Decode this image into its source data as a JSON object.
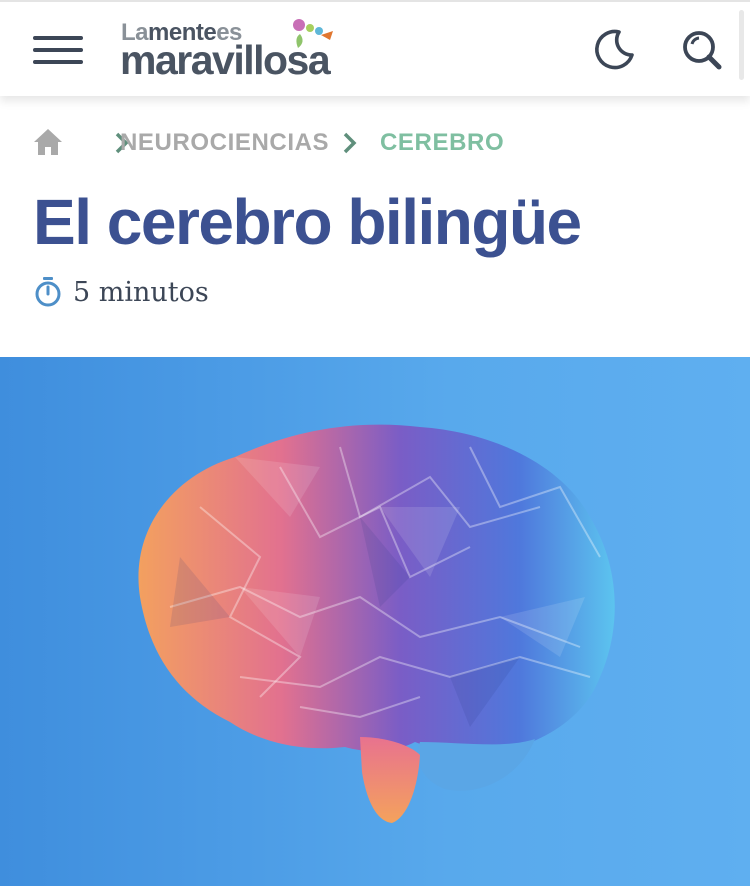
{
  "header": {
    "logo": {
      "line1_a": "La",
      "line1_b": "mente",
      "line1_c": "es",
      "line2": "maravillosa"
    },
    "icons": {
      "menu": "hamburger-menu-icon",
      "theme": "moon-icon",
      "search": "search-icon"
    }
  },
  "breadcrumb": {
    "home_icon": "home-icon",
    "items": [
      {
        "label": "NEUROCIENCIAS"
      },
      {
        "label": "CEREBRO"
      }
    ]
  },
  "article": {
    "title": "El cerebro bilingüe",
    "read_time": "5 minutos",
    "timer_icon": "stopwatch-icon",
    "hero_image": "low-poly-brain-illustration"
  },
  "colors": {
    "title": "#3c5191",
    "breadcrumb_muted": "#a9a9a9",
    "breadcrumb_active": "#7fbfa1",
    "chevron": "#5f8f7c",
    "hero_background": "#4b9be5"
  }
}
